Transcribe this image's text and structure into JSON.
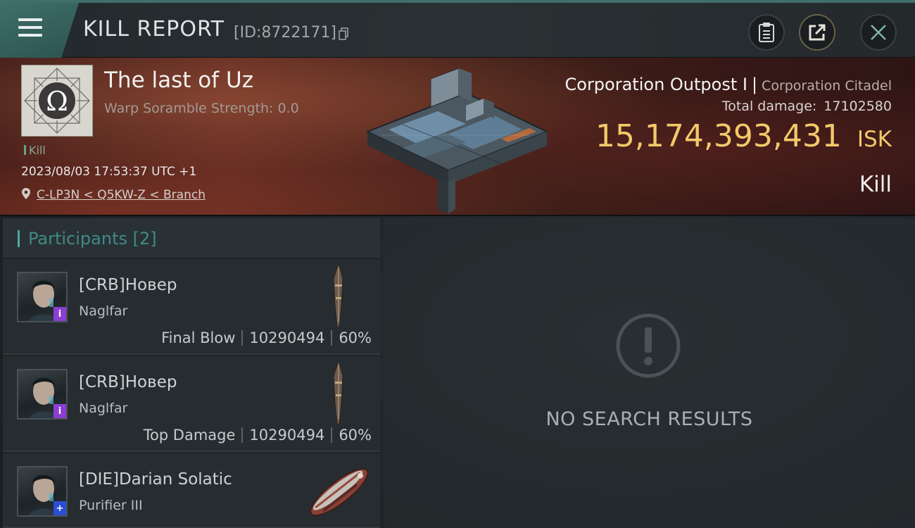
{
  "header": {
    "title": "KILL REPORT",
    "report_id": "[ID:8722171]"
  },
  "victim": {
    "name": "The last of Uz",
    "warp_scramble": "Warp Soramble Strength: 0.0",
    "tag": "Kill",
    "timestamp": "2023/08/03 17:53:37 UTC +1",
    "location": "C-LP3N < Q5KW-Z < Branch"
  },
  "target": {
    "name": "Corporation Outpost I",
    "separator": "|",
    "type": "Corporation Citadel",
    "damage_label": "Total damage:",
    "damage_value": "17102580",
    "isk_value": "15,174,393,431",
    "isk_unit": "ISK",
    "result": "Kill"
  },
  "participants": {
    "title": "Participants [2]",
    "rows": [
      {
        "name": "[CRB]Новер",
        "ship": "Naglfar",
        "role": "Final Blow",
        "damage": "10290494",
        "percent": "60%",
        "badge": "i",
        "badge_color": "#8a3fd1"
      },
      {
        "name": "[CRB]Новер",
        "ship": "Naglfar",
        "role": "Top Damage",
        "damage": "10290494",
        "percent": "60%",
        "badge": "i",
        "badge_color": "#8a3fd1"
      },
      {
        "name": "[DIE]Darian Solatic",
        "ship": "Purifier III",
        "role": "",
        "damage": "",
        "percent": "",
        "badge": "+",
        "badge_color": "#2a4fd6"
      }
    ]
  },
  "results": {
    "empty_text": "NO SEARCH RESULTS"
  },
  "colors": {
    "accent_teal": "#3f6e68",
    "isk_gold": "#f2c96b"
  },
  "icons": [
    "menu-icon",
    "copy-icon",
    "clipboard-icon",
    "share-icon",
    "close-icon",
    "location-pin-icon",
    "alert-icon"
  ]
}
